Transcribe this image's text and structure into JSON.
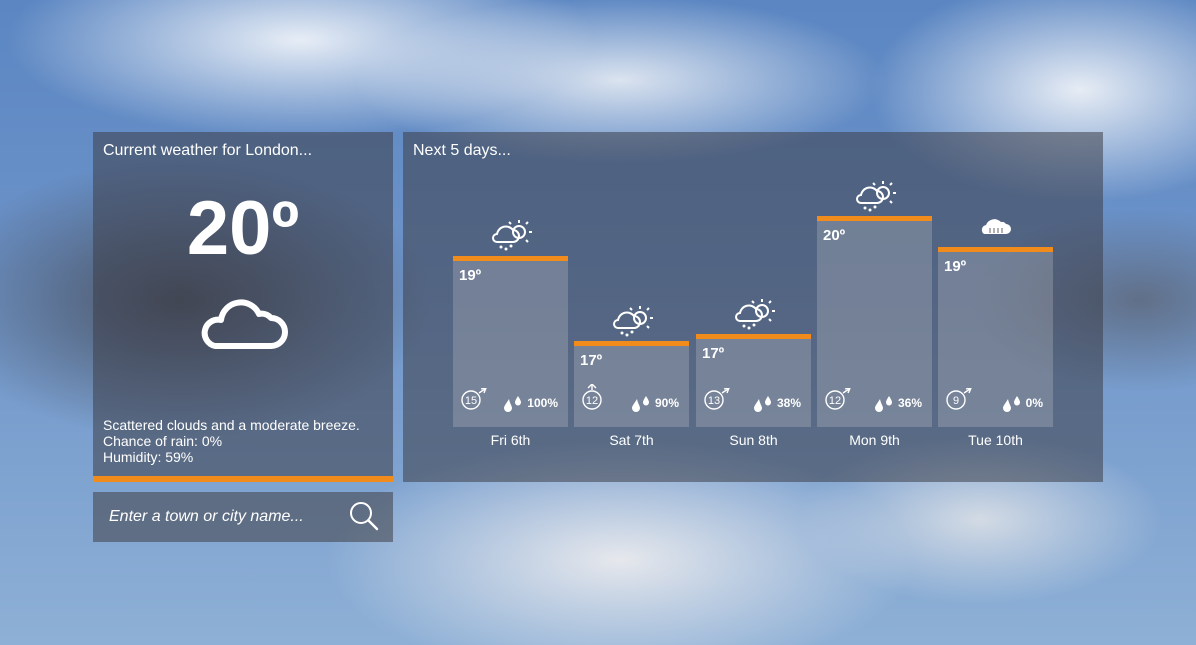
{
  "current": {
    "title": "Current weather for London...",
    "temperature": "20º",
    "icon": "cloud-icon",
    "description": "Scattered clouds and a moderate breeze.",
    "rain_chance": "Chance of rain: 0%",
    "humidity": "Humidity: 59%"
  },
  "search": {
    "placeholder": "Enter a town or city name...",
    "icon": "search-icon"
  },
  "forecast": {
    "title": "Next 5 days...",
    "days": [
      {
        "label": "Fri 6th",
        "temp": "19º",
        "wind": "15",
        "rain": "100%",
        "icon": "sun-cloud-rain-icon"
      },
      {
        "label": "Sat 7th",
        "temp": "17º",
        "wind": "12",
        "rain": "90%",
        "icon": "sun-cloud-rain-icon"
      },
      {
        "label": "Sun 8th",
        "temp": "17º",
        "wind": "13",
        "rain": "38%",
        "icon": "sun-cloud-rain-icon"
      },
      {
        "label": "Mon 9th",
        "temp": "20º",
        "wind": "12",
        "rain": "36%",
        "icon": "sun-cloud-rain-icon"
      },
      {
        "label": "Tue 10th",
        "temp": "19º",
        "wind": "9",
        "rain": "0%",
        "icon": "cloud-icon"
      }
    ]
  },
  "colors": {
    "accent": "#f18b1c"
  }
}
